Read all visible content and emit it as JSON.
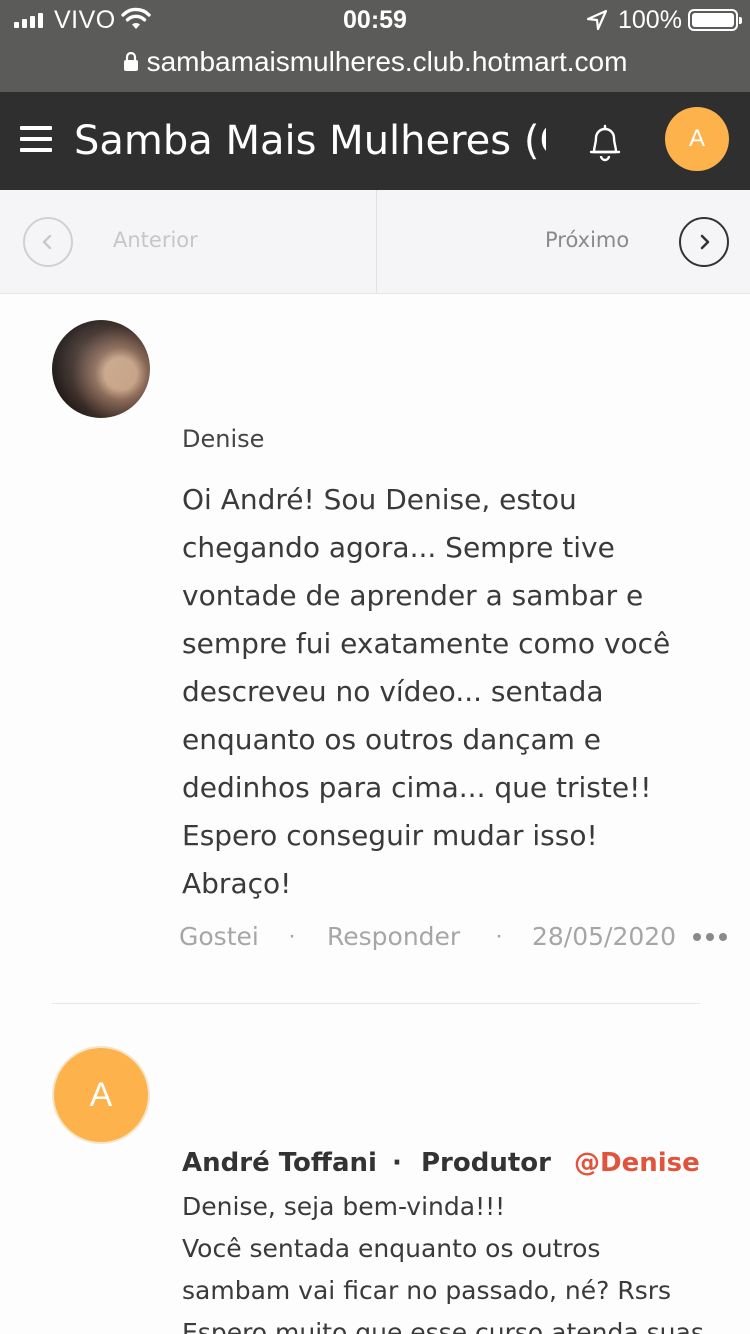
{
  "status_bar": {
    "carrier": "VIVO",
    "time": "00:59",
    "battery": "100%"
  },
  "browser": {
    "url": "sambamaismulheres.club.hotmart.com"
  },
  "header": {
    "title": "Samba Mais Mulheres (Curso Online)",
    "avatar_letter": "A",
    "bg_color": "#2f2f2f",
    "avatar_color": "#fdb24b"
  },
  "pager": {
    "prev_label": "Anterior",
    "next_label": "Próximo"
  },
  "comments": [
    {
      "author": "Denise",
      "text_lines": [
        "Oi André! Sou Denise, estou",
        "chegando agora... Sempre tive",
        "vontade de aprender a sambar e",
        "sempre fui exatamente como você",
        "descreveu no vídeo... sentada",
        "enquanto os outros dançam e",
        "dedinhos para cima... que triste!!",
        "Espero conseguir mudar isso!",
        "Abraço!"
      ],
      "like_label": "Gostei",
      "reply_label": "Responder",
      "separator": "·",
      "date": "28/05/2020"
    },
    {
      "author": "André Toffani",
      "dot": "·",
      "role": "Produtor",
      "mention": "@Denise",
      "avatar_letter": "A",
      "mention_color": "#e2533c",
      "text_lines": [
        "Denise, seja bem-vinda!!!",
        "Você sentada enquanto os outros",
        "sambam vai ficar no passado, né? Rsrs",
        "Espero muito que esse curso atenda suas"
      ]
    }
  ]
}
